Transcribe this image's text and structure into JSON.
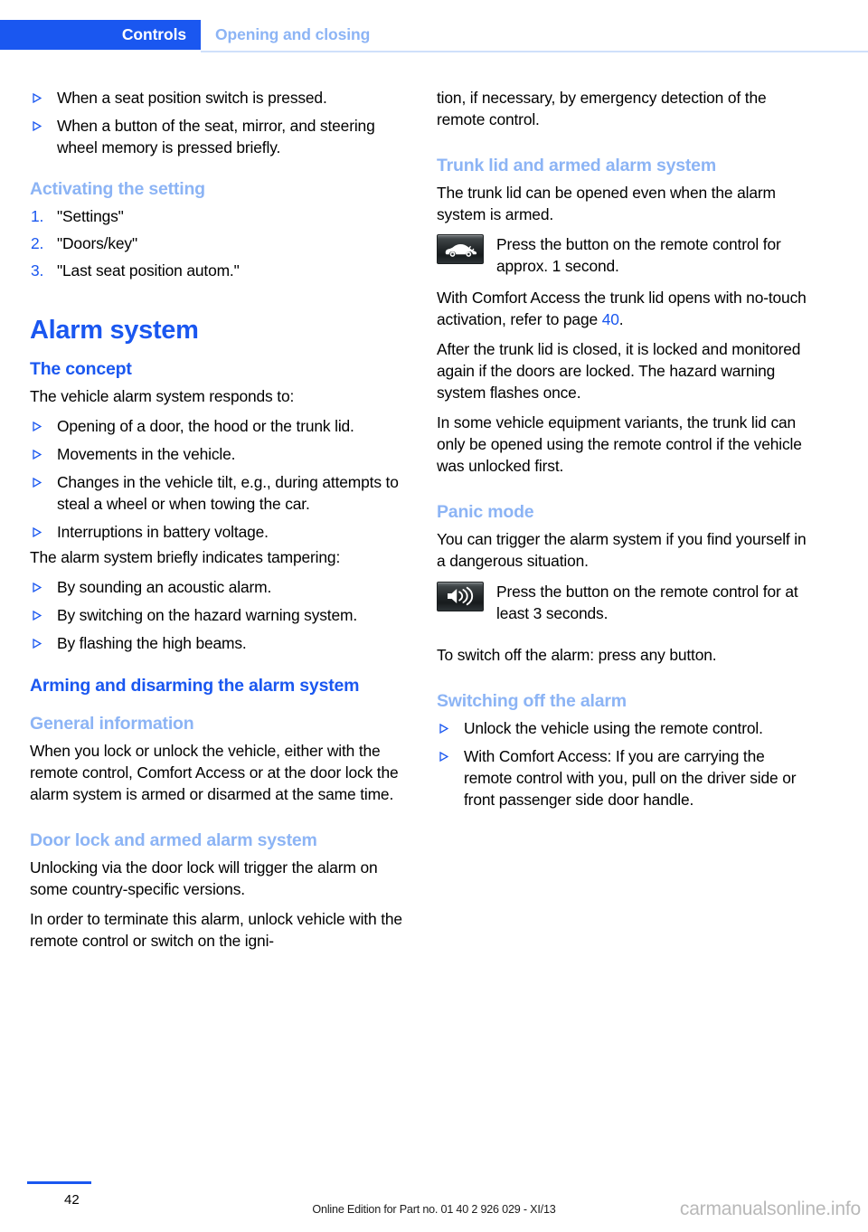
{
  "header": {
    "chapter": "Controls",
    "section": "Opening and closing"
  },
  "left_column": {
    "top_bullets": [
      "When a seat position switch is pressed.",
      "When a button of the seat, mirror, and steering wheel memory is pressed briefly."
    ],
    "activating_heading": "Activating the setting",
    "activating_steps": [
      {
        "marker": "1.",
        "text": "\"Settings\""
      },
      {
        "marker": "2.",
        "text": "\"Doors/key\""
      },
      {
        "marker": "3.",
        "text": "\"Last seat position autom.\""
      }
    ],
    "alarm_title": "Alarm system",
    "concept_heading": "The concept",
    "concept_intro": "The vehicle alarm system responds to:",
    "concept_bullets": [
      "Opening of a door, the hood or the trunk lid.",
      "Movements in the vehicle.",
      "Changes in the vehicle tilt, e.g., during attempts to steal a wheel or when towing the car.",
      "Interruptions in battery voltage."
    ],
    "tampering_intro": "The alarm system briefly indicates tampering:",
    "tampering_bullets": [
      "By sounding an acoustic alarm.",
      "By switching on the hazard warning system.",
      "By flashing the high beams."
    ],
    "arming_heading": "Arming and disarming the alarm system",
    "general_info_heading": "General information",
    "general_info_text": "When you lock or unlock the vehicle, either with the remote control, Comfort Access or at the door lock the alarm system is armed or disarmed at the same time.",
    "door_lock_heading": "Door lock and armed alarm system",
    "door_lock_p1": "Unlocking via the door lock will trigger the alarm on some country-specific versions.",
    "door_lock_p2": "In order to terminate this alarm, unlock vehicle with the remote control or switch on the igni-"
  },
  "right_column": {
    "continuation_text": "tion, if necessary, by emergency detection of the remote control.",
    "trunk_heading": "Trunk lid and armed alarm system",
    "trunk_intro": "The trunk lid can be opened even when the alarm system is armed.",
    "trunk_icon_name": "trunk-open-button-icon",
    "trunk_icon_text": "Press the button on the remote control for approx. 1 second.",
    "comfort_access_text_before": "With Comfort Access the trunk lid opens with no-touch activation, refer to page ",
    "comfort_access_page_ref": "40",
    "comfort_access_text_after": ".",
    "after_closed_text": "After the trunk lid is closed, it is locked and monitored again if the doors are locked. The hazard warning system flashes once.",
    "variants_text": "In some vehicle equipment variants, the trunk lid can only be opened using the remote control if the vehicle was unlocked first.",
    "panic_heading": "Panic mode",
    "panic_intro": "You can trigger the alarm system if you find yourself in a dangerous situation.",
    "panic_icon_name": "horn-speaker-button-icon",
    "panic_icon_text": "Press the button on the remote control for at least 3 seconds.",
    "switch_off_text": "To switch off the alarm: press any button.",
    "switching_off_heading": "Switching off the alarm",
    "switching_off_bullets": [
      "Unlock the vehicle using the remote control.",
      "With Comfort Access: If you are carrying the remote control with you, pull on the driver side or front passenger side door handle."
    ]
  },
  "footer": {
    "page_number": "42",
    "edition": "Online Edition for Part no. 01 40 2 926 029 - XI/13",
    "watermark": "carmanualsonline.info"
  },
  "colors": {
    "accent_strong": "#1a57f0",
    "accent_light": "#8cb4f5",
    "rule_light": "#cfe0fb",
    "watermark_gray": "#b8b8b8"
  }
}
